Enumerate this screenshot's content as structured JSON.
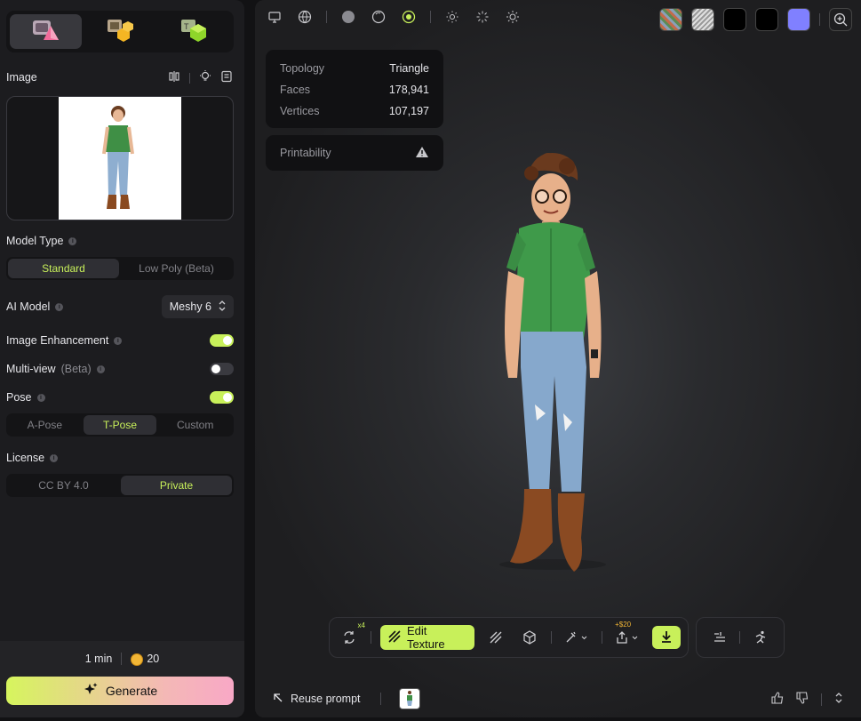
{
  "left_panel": {
    "mode_tabs": [
      {
        "name": "image-to-3d",
        "icon": "image-to-3d-icon",
        "active": true
      },
      {
        "name": "multi-object",
        "icon": "cubes-icon",
        "active": false
      },
      {
        "name": "text-to-texture",
        "icon": "texture-cube-icon",
        "active": false
      }
    ],
    "image_section_label": "Image",
    "model_type": {
      "label": "Model Type",
      "options": [
        "Standard",
        "Low Poly (Beta)"
      ],
      "selected": "Standard"
    },
    "ai_model": {
      "label": "AI Model",
      "value": "Meshy 6"
    },
    "image_enhancement": {
      "label": "Image Enhancement",
      "on": true
    },
    "multi_view": {
      "label": "Multi-view",
      "suffix": "(Beta)",
      "on": false
    },
    "pose": {
      "label": "Pose",
      "on": true,
      "options": [
        "A-Pose",
        "T-Pose",
        "Custom"
      ],
      "selected": "T-Pose"
    },
    "license": {
      "label": "License",
      "options": [
        "CC BY 4.0",
        "Private"
      ],
      "selected": "Private"
    },
    "footer": {
      "time": "1 min",
      "credits": "20",
      "generate_label": "Generate"
    }
  },
  "viewport": {
    "stats": [
      {
        "key": "Topology",
        "value": "Triangle"
      },
      {
        "key": "Faces",
        "value": "178,941"
      },
      {
        "key": "Vertices",
        "value": "107,197"
      }
    ],
    "printability_label": "Printability",
    "swatch_colors": [
      "#7a9a6a",
      "#cfcfcf",
      "#000000",
      "#000000",
      "#8080ff"
    ],
    "toolbar": {
      "remesh_badge": "x4",
      "edit_texture_label": "Edit Texture",
      "export_badge": "+$20"
    },
    "reuse_prompt_label": "Reuse prompt"
  },
  "colors": {
    "accent": "#c8f05a",
    "panel": "#1c1c1f"
  }
}
